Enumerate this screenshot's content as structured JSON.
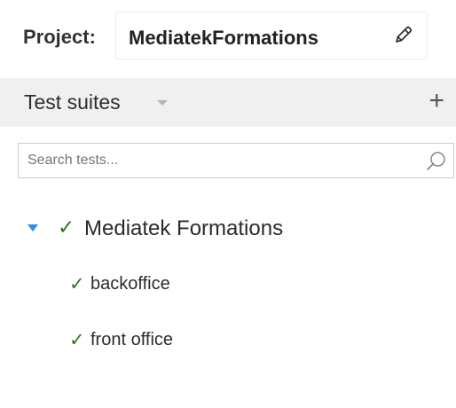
{
  "project": {
    "label": "Project:",
    "name": "MediatekFormations"
  },
  "suites": {
    "title": "Test suites",
    "add_label": "+"
  },
  "search": {
    "placeholder": "Search tests...",
    "value": ""
  },
  "tree": {
    "root": {
      "check": "✓",
      "label": "Mediatek Formations",
      "expanded": true
    },
    "children": [
      {
        "check": "✓",
        "label": "backoffice"
      },
      {
        "check": "✓",
        "label": "front office"
      }
    ]
  },
  "colors": {
    "check": "#2a7a14",
    "caret": "#2e8fe8",
    "bar": "#f0f0f0"
  },
  "icons": {
    "edit": "pencil-icon",
    "search": "magnifier-icon",
    "add": "plus-icon",
    "suites_dropdown": "caret-down-icon",
    "expand": "caret-down-icon"
  }
}
